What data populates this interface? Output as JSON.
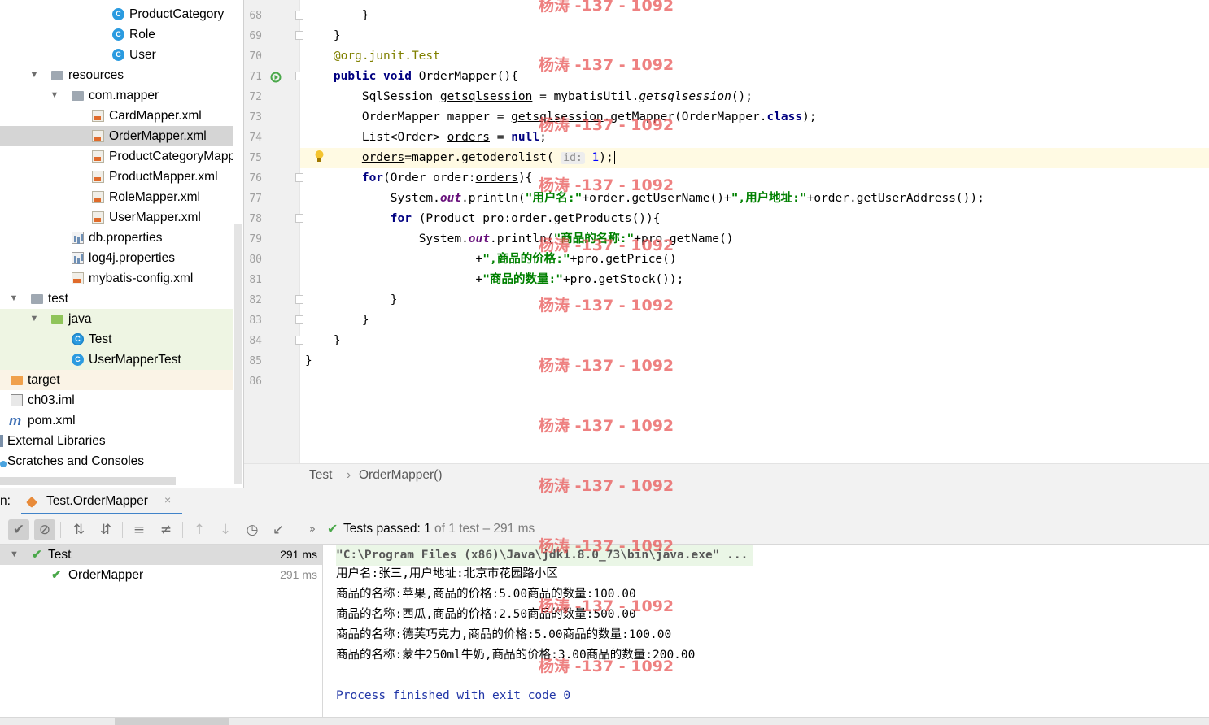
{
  "project_tree": {
    "items": [
      {
        "label": "ProductCategory",
        "icon": "class-icon"
      },
      {
        "label": "Role",
        "icon": "class-icon"
      },
      {
        "label": "User",
        "icon": "class-icon"
      },
      {
        "label": "resources",
        "icon": "resources-folder-icon",
        "expanded": true
      },
      {
        "label": "com.mapper",
        "icon": "folder-icon",
        "expanded": true
      },
      {
        "label": "CardMapper.xml",
        "icon": "xml-file-icon"
      },
      {
        "label": "OrderMapper.xml",
        "icon": "xml-file-icon",
        "selected": true
      },
      {
        "label": "ProductCategoryMapp",
        "icon": "xml-file-icon"
      },
      {
        "label": "ProductMapper.xml",
        "icon": "xml-file-icon"
      },
      {
        "label": "RoleMapper.xml",
        "icon": "xml-file-icon"
      },
      {
        "label": "UserMapper.xml",
        "icon": "xml-file-icon"
      },
      {
        "label": "db.properties",
        "icon": "properties-file-icon"
      },
      {
        "label": "log4j.properties",
        "icon": "properties-file-icon"
      },
      {
        "label": "mybatis-config.xml",
        "icon": "xml-file-icon"
      },
      {
        "label": "test",
        "icon": "folder-icon",
        "expanded": true
      },
      {
        "label": "java",
        "icon": "test-folder-icon",
        "expanded": true
      },
      {
        "label": "Test",
        "icon": "test-class-icon"
      },
      {
        "label": "UserMapperTest",
        "icon": "class-icon"
      },
      {
        "label": "target",
        "icon": "excluded-folder-icon"
      },
      {
        "label": "ch03.iml",
        "icon": "iml-file-icon"
      },
      {
        "label": "pom.xml",
        "icon": "maven-icon"
      },
      {
        "label": "External Libraries",
        "icon": "library-icon"
      },
      {
        "label": "Scratches and Consoles",
        "icon": "scratch-icon"
      }
    ]
  },
  "editor": {
    "line_numbers": [
      "68",
      "69",
      "70",
      "71",
      "72",
      "73",
      "74",
      "75",
      "76",
      "77",
      "78",
      "79",
      "80",
      "81",
      "82",
      "83",
      "84",
      "85",
      "86"
    ],
    "inlay_hint": "id:",
    "breadcrumb": [
      "Test",
      "OrderMapper()"
    ],
    "breadcrumb_sep": "›"
  },
  "run_window": {
    "prefix": "n:",
    "tab_label": "Test.OrderMapper",
    "tab_close": "×",
    "status": {
      "prefix": "Tests passed:",
      "passed": "1",
      "rest": "of 1 test – 291 ms"
    },
    "test_tree": [
      {
        "label": "Test",
        "time": "291 ms"
      },
      {
        "label": "OrderMapper",
        "time": "291 ms"
      }
    ],
    "console_lines": [
      "\"C:\\Program Files (x86)\\Java\\jdk1.8.0_73\\bin\\java.exe\" ...",
      "用户名:张三,用户地址:北京市花园路小区",
      "商品的名称:苹果,商品的价格:5.00商品的数量:100.00",
      "商品的名称:西瓜,商品的价格:2.50商品的数量:500.00",
      "商品的名称:德芙巧克力,商品的价格:5.00商品的数量:100.00",
      "商品的名称:蒙牛250ml牛奶,商品的价格:3.00商品的数量:200.00",
      "",
      "Process finished with exit code 0"
    ]
  },
  "watermark": "杨涛 -137 - 1092",
  "colors": {
    "keyword": "#000080",
    "string": "#008000",
    "annotation": "#808000",
    "static_field": "#660e7a",
    "selection": "#d5d5d5",
    "pass_green": "#4aa84a",
    "watermark": "#e85050"
  }
}
